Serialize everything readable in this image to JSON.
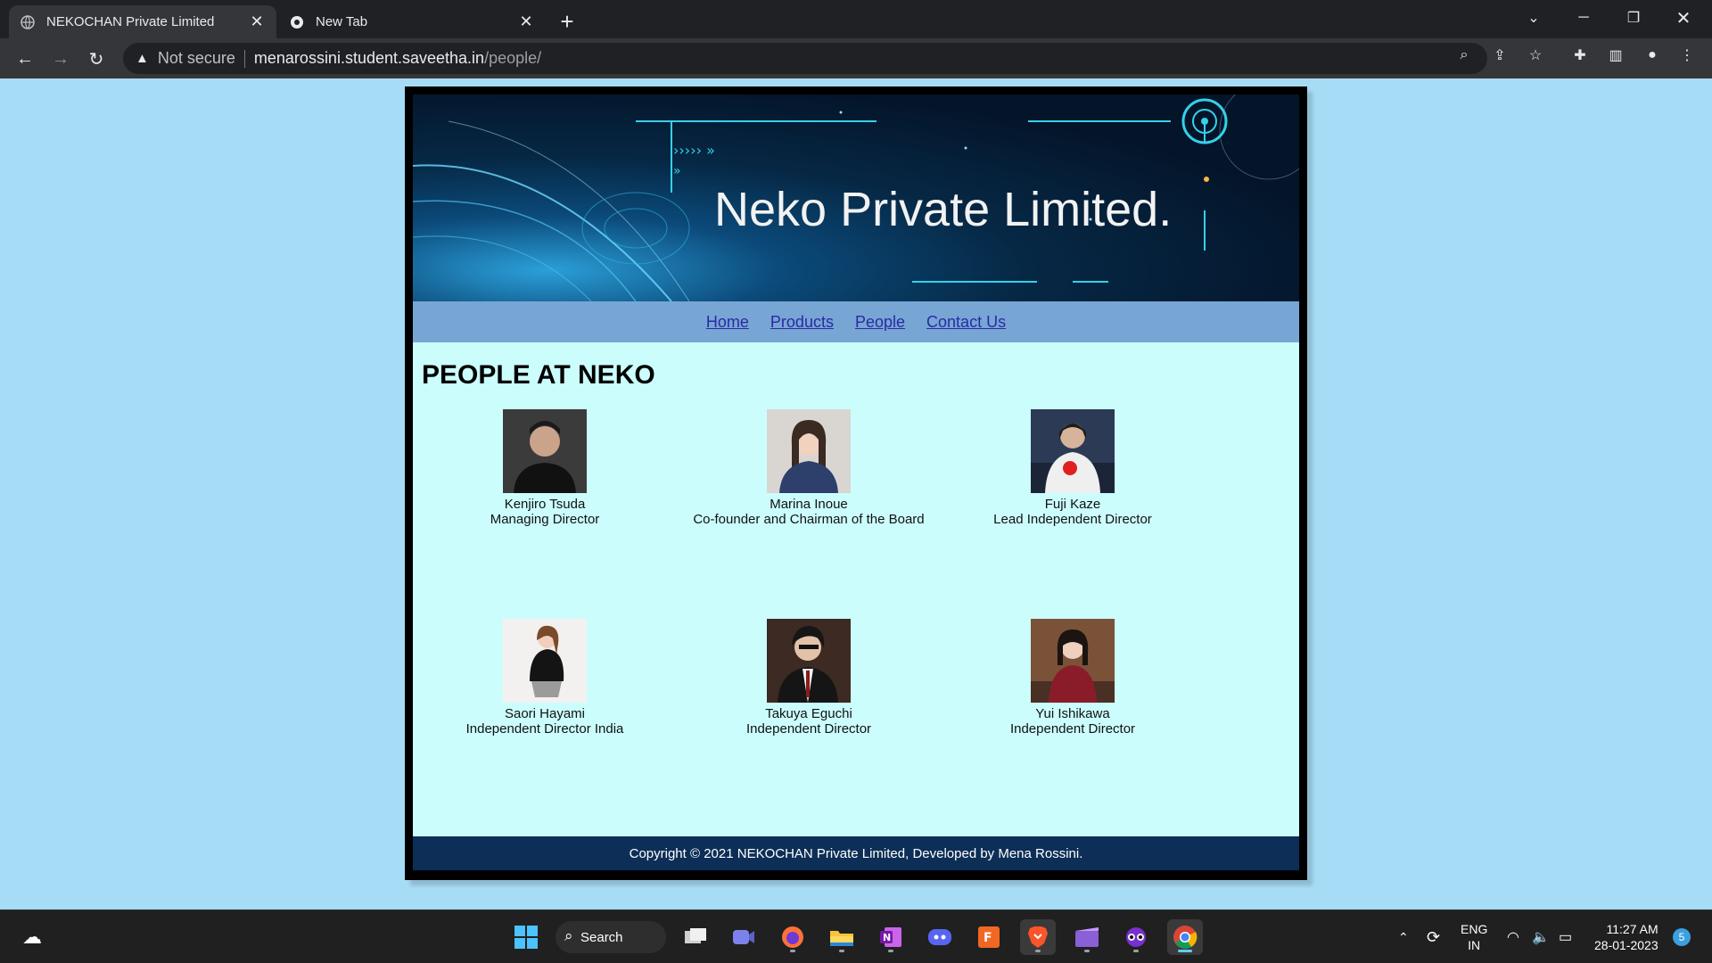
{
  "browser": {
    "tabs": [
      {
        "title": "NEKOCHAN Private Limited",
        "active": true
      },
      {
        "title": "New Tab",
        "active": false
      }
    ],
    "omnibox": {
      "security_label": "Not secure",
      "url_host": "menarossini.student.saveetha.in",
      "url_path": "/people/"
    }
  },
  "page": {
    "banner_title": "Neko Private Limited.",
    "nav": [
      "Home",
      "Products",
      "People",
      "Contact Us"
    ],
    "heading": "PEOPLE AT NEKO",
    "people": [
      {
        "name": "Kenjiro Tsuda",
        "role": "Managing Director"
      },
      {
        "name": "Marina Inoue",
        "role": "Co-founder and Chairman of the Board"
      },
      {
        "name": "Fuji Kaze",
        "role": "Lead Independent Director"
      },
      {
        "name": "Saori Hayami",
        "role": "Independent Director India"
      },
      {
        "name": "Takuya Eguchi",
        "role": "Independent Director"
      },
      {
        "name": "Yui Ishikawa",
        "role": "Independent Director"
      }
    ],
    "footer": "Copyright © 2021 NEKOCHAN Private Limited, Developed by Mena Rossini."
  },
  "taskbar": {
    "search_label": "Search",
    "language": "ENG",
    "region": "IN",
    "time": "11:27 AM",
    "date": "28-01-2023",
    "notification_count": "5"
  },
  "colors": {
    "page_background": "#a6dcf5",
    "content_background": "#ccfdfd",
    "navbar_background": "#78a6d4",
    "footer_background": "#0d2f57"
  }
}
